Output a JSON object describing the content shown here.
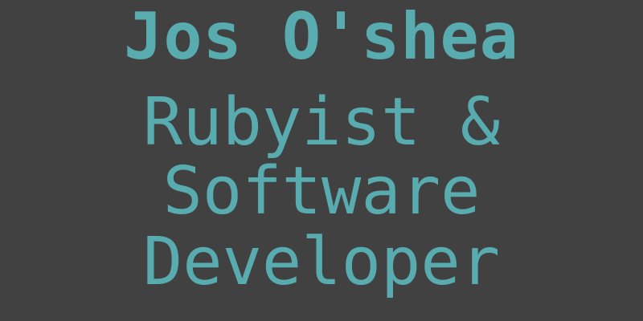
{
  "profile": {
    "name": "Jos O'shea",
    "tagline_lines": [
      "Rubyist &",
      "Software",
      "Developer"
    ]
  },
  "colors": {
    "background": "#414141",
    "text": "#58acb0"
  }
}
